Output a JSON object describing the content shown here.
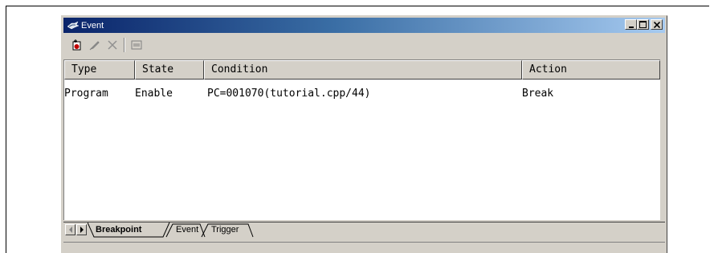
{
  "window": {
    "title": "Event",
    "controls": {
      "minimize": "_",
      "maximize": "□",
      "close": "×"
    }
  },
  "toolbar": {
    "buttons": [
      {
        "name": "add-icon"
      },
      {
        "name": "edit-icon"
      },
      {
        "name": "delete-icon"
      },
      {
        "name": "properties-icon"
      }
    ]
  },
  "table": {
    "columns": [
      "Type",
      "State",
      "Condition",
      "Action"
    ],
    "rows": [
      {
        "type": "Program",
        "state": "Enable",
        "condition": "PC=001070(tutorial.cpp/44)",
        "action": "Break"
      }
    ]
  },
  "tabs": [
    "Breakpoint",
    "Event",
    "Trigger"
  ],
  "active_tab": "Breakpoint",
  "colors": {
    "titlebar_start": "#0a246a",
    "titlebar_end": "#a6caf0",
    "face": "#d4d0c8"
  }
}
